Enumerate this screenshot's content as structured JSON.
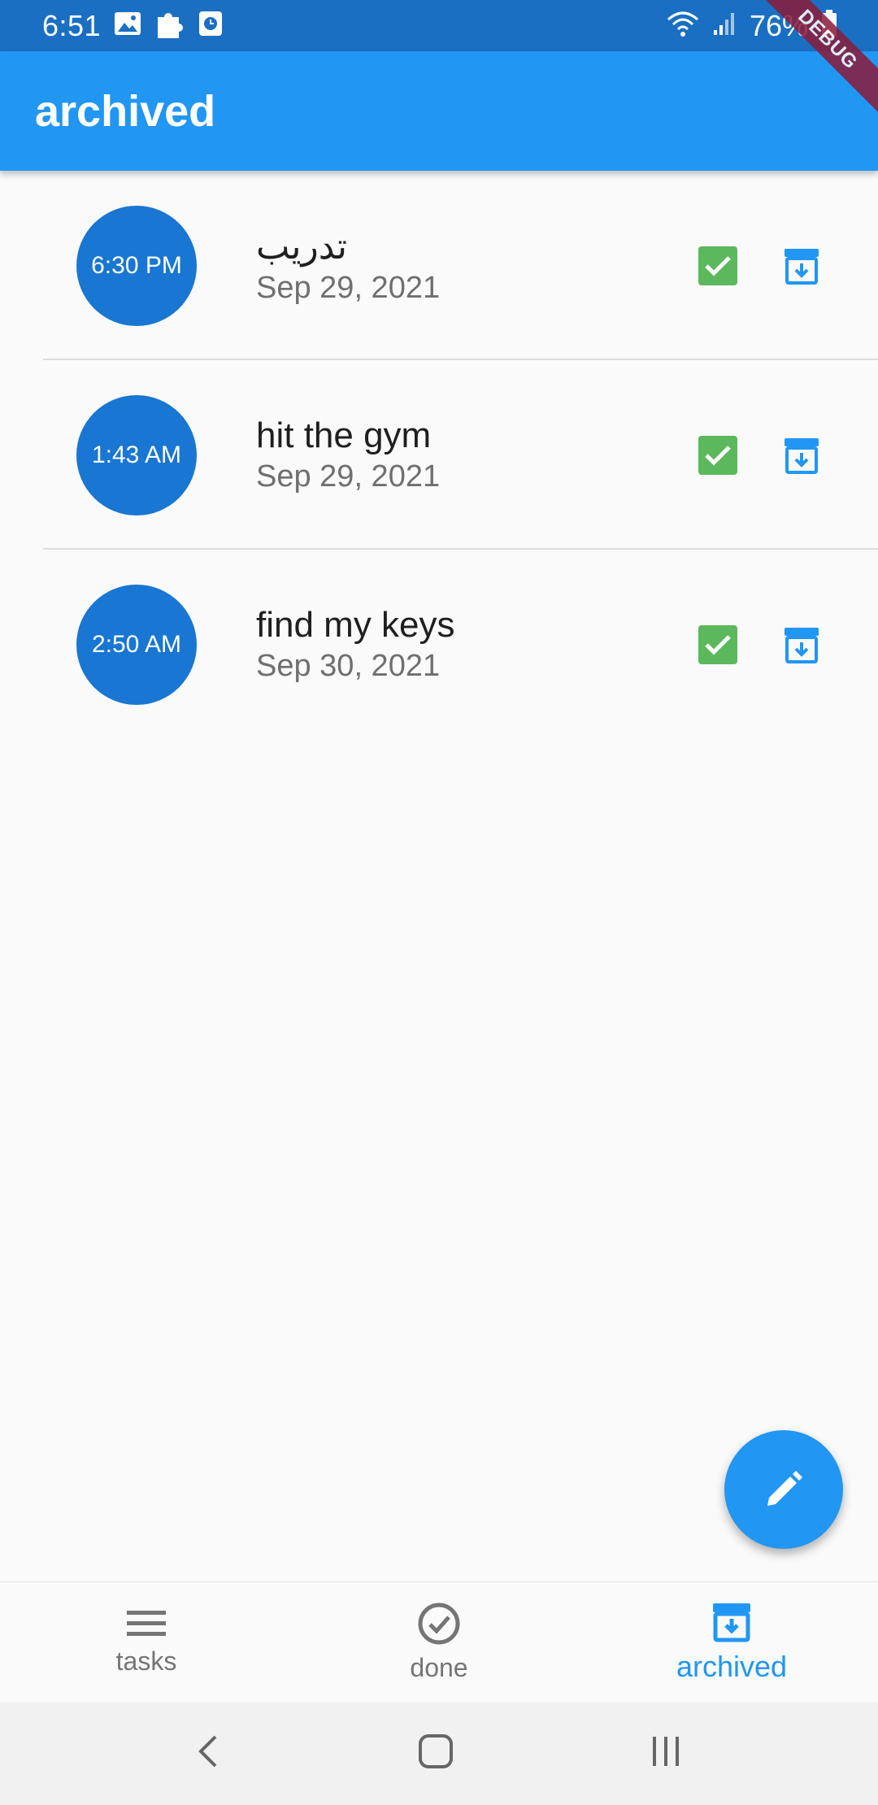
{
  "status_bar": {
    "time": "6:51",
    "battery": "76%",
    "icons": [
      "image-icon",
      "puzzle-icon",
      "clock-icon",
      "wifi-icon",
      "signal-icon",
      "battery-icon"
    ]
  },
  "debug_banner": "DEBUG",
  "app_bar": {
    "title": "archived"
  },
  "tasks": [
    {
      "time": "6:30 PM",
      "title": "تدريب",
      "date": "Sep 29, 2021"
    },
    {
      "time": "1:43 AM",
      "title": "hit the gym",
      "date": "Sep 29, 2021"
    },
    {
      "time": "2:50 AM",
      "title": "find my keys",
      "date": "Sep 30, 2021"
    }
  ],
  "bottom_nav": {
    "items": [
      {
        "label": "tasks",
        "icon": "menu-icon",
        "active": false
      },
      {
        "label": "done",
        "icon": "check-circle-icon",
        "active": false
      },
      {
        "label": "archived",
        "icon": "archive-icon",
        "active": true
      }
    ]
  },
  "colors": {
    "app_bar": "#2196f3",
    "status_bar": "#1a6fc2",
    "time_circle": "#1976d2",
    "check": "#5cb85c",
    "active_nav": "#2196f3"
  }
}
